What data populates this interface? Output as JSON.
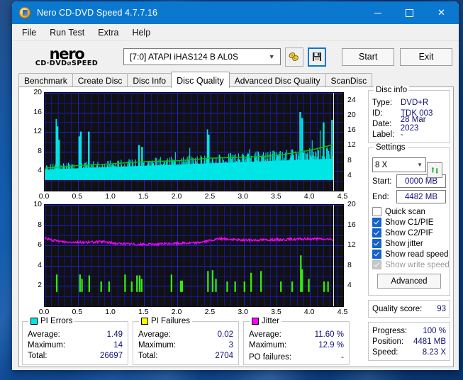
{
  "window": {
    "title": "Nero CD-DVD Speed 4.7.7.16",
    "icon": "disc-icon",
    "minimize": "—",
    "maximize": "□",
    "close": "✕",
    "accent": "#0b78d0"
  },
  "menu": {
    "items": [
      "File",
      "Run Test",
      "Extra",
      "Help"
    ]
  },
  "toolbar": {
    "logo_line1": "nero",
    "logo_line2": "CD·DVD⌀SPEED",
    "drive": "[7:0]   ATAPI iHAS124  B AL0S",
    "drive_chevron": "▼",
    "eject_icon": "disc-eject-icon",
    "save_icon": "floppy-save-icon",
    "start_label": "Start",
    "exit_label": "Exit"
  },
  "tabs": {
    "items": [
      "Benchmark",
      "Create Disc",
      "Disc Info",
      "Disc Quality",
      "Advanced Disc Quality",
      "ScanDisc"
    ],
    "active": "Disc Quality"
  },
  "disc_info": {
    "caption": "Disc info",
    "rows": [
      {
        "key": "Type:",
        "value": "DVD+R"
      },
      {
        "key": "ID:",
        "value": "TDK 003"
      },
      {
        "key": "Date:",
        "value": "28 Mar 2023"
      },
      {
        "key": "Label:",
        "value": "-"
      }
    ]
  },
  "settings": {
    "caption": "Settings",
    "speed": "8 X",
    "speed_chevron": "▼",
    "refresh_icon": "refresh-arrows-icon",
    "start_label": "Start:",
    "start_value": "0000 MB",
    "end_label": "End:",
    "end_value": "4482 MB",
    "checkboxes": [
      {
        "label": "Quick scan",
        "checked": false,
        "disabled": false
      },
      {
        "label": "Show C1/PIE",
        "checked": true,
        "disabled": false
      },
      {
        "label": "Show C2/PIF",
        "checked": true,
        "disabled": false
      },
      {
        "label": "Show jitter",
        "checked": true,
        "disabled": false
      },
      {
        "label": "Show read speed",
        "checked": true,
        "disabled": false
      },
      {
        "label": "Show write speed",
        "checked": true,
        "disabled": true
      }
    ],
    "advanced_label": "Advanced"
  },
  "quality": {
    "label": "Quality score:",
    "value": "93"
  },
  "progress": {
    "rows": [
      {
        "key": "Progress:",
        "value": "100 %"
      },
      {
        "key": "Position:",
        "value": "4481 MB"
      },
      {
        "key": "Speed:",
        "value": "8.23 X"
      }
    ]
  },
  "stats": {
    "pi_errors": {
      "caption": "PI Errors",
      "color": "#00e5e5",
      "rows": [
        {
          "key": "Average:",
          "value": "1.49"
        },
        {
          "key": "Maximum:",
          "value": "14"
        },
        {
          "key": "Total:",
          "value": "26697"
        }
      ]
    },
    "pi_failures": {
      "caption": "PI Failures",
      "color": "#ffff00",
      "rows": [
        {
          "key": "Average:",
          "value": "0.02"
        },
        {
          "key": "Maximum:",
          "value": "3"
        },
        {
          "key": "Total:",
          "value": "2704"
        }
      ]
    },
    "jitter": {
      "caption": "Jitter",
      "color": "#ff00ff",
      "rows": [
        {
          "key": "Average:",
          "value": "11.60 %"
        },
        {
          "key": "Maximum:",
          "value": "12.9 %"
        },
        {
          "key": "PO failures:",
          "value": "-"
        }
      ]
    }
  },
  "chart_data": [
    {
      "type": "bar",
      "title": "PI Errors / Read speed",
      "xlabel": "",
      "ylabel": "PI Errors",
      "xlim": [
        0.0,
        4.5
      ],
      "ylim": [
        0,
        20
      ],
      "y2lim": [
        0,
        26
      ],
      "xticks": [
        "0.0",
        "0.5",
        "1.0",
        "1.5",
        "2.0",
        "2.5",
        "3.0",
        "3.5",
        "4.0",
        "4.5"
      ],
      "yticks": [
        "4",
        "8",
        "12",
        "16",
        "20"
      ],
      "y2ticks": [
        "4",
        "8",
        "12",
        "16",
        "20",
        "24"
      ],
      "grid": true,
      "bg": "#111111",
      "grid_color": "#1f1fd8",
      "series": [
        {
          "name": "PI Errors",
          "kind": "bar",
          "color": "#00e5e5",
          "baseline": 2.6,
          "peaks": [
            [
              0.17,
              14
            ],
            [
              0.19,
              12.3
            ],
            [
              0.21,
              9.2
            ],
            [
              0.52,
              10.0
            ],
            [
              0.54,
              11.1
            ],
            [
              0.66,
              11.1
            ],
            [
              1.42,
              8.0
            ],
            [
              1.46,
              7.6
            ],
            [
              2.45,
              11.6
            ],
            [
              2.47,
              10.4
            ],
            [
              3.85,
              15.6
            ],
            [
              3.88,
              14.2
            ],
            [
              4.2,
              13.2
            ],
            [
              4.33,
              13.8
            ]
          ]
        },
        {
          "name": "Read speed",
          "kind": "line",
          "color": "#00d000",
          "points": [
            [
              0.0,
              2.7
            ],
            [
              0.5,
              3.3
            ],
            [
              1.0,
              3.7
            ],
            [
              1.5,
              4.2
            ],
            [
              2.0,
              4.4
            ],
            [
              2.5,
              5.0
            ],
            [
              3.0,
              5.2
            ],
            [
              3.5,
              5.6
            ],
            [
              4.0,
              6.8
            ],
            [
              4.35,
              8.1
            ]
          ]
        }
      ],
      "end_marker": 4.35
    },
    {
      "type": "line",
      "title": "Jitter / PI Failures",
      "xlabel": "",
      "ylabel": "PI Failures",
      "xlim": [
        0.0,
        4.5
      ],
      "ylim": [
        0,
        10
      ],
      "y2lim": [
        0,
        20
      ],
      "xticks": [
        "0.0",
        "0.5",
        "1.0",
        "1.5",
        "2.0",
        "2.5",
        "3.0",
        "3.5",
        "4.0",
        "4.5"
      ],
      "yticks": [
        "2",
        "4",
        "6",
        "8",
        "10"
      ],
      "y2ticks": [
        "4",
        "8",
        "12",
        "16",
        "20"
      ],
      "grid": true,
      "bg": "#111111",
      "grid_color": "#1f1fd8",
      "series": [
        {
          "name": "Jitter",
          "kind": "line",
          "color": "#ff00ff",
          "points": [
            [
              0.0,
              12.4
            ],
            [
              0.1,
              11.9
            ],
            [
              0.3,
              11.5
            ],
            [
              0.6,
              11.4
            ],
            [
              0.9,
              11.5
            ],
            [
              1.1,
              11.1
            ],
            [
              1.5,
              10.9
            ],
            [
              1.9,
              11.1
            ],
            [
              2.3,
              11.3
            ],
            [
              2.65,
              12.2
            ],
            [
              3.0,
              11.9
            ],
            [
              3.4,
              12.0
            ],
            [
              3.8,
              12.1
            ],
            [
              4.1,
              12.2
            ],
            [
              4.35,
              12.0
            ]
          ]
        },
        {
          "name": "PI Failures",
          "kind": "bar",
          "color": "#33ee00",
          "peaks": [
            [
              0.17,
              2.0
            ],
            [
              0.52,
              2.0
            ],
            [
              0.55,
              1.5
            ],
            [
              0.66,
              1.9
            ],
            [
              0.84,
              1.2
            ],
            [
              0.96,
              1.2
            ],
            [
              1.2,
              2.0
            ],
            [
              1.3,
              1.2
            ],
            [
              1.38,
              1.9
            ],
            [
              1.42,
              1.9
            ],
            [
              1.45,
              1.5
            ],
            [
              1.9,
              2.0
            ],
            [
              2.04,
              1.3
            ],
            [
              2.06,
              1.3
            ],
            [
              2.45,
              2.4
            ],
            [
              2.52,
              2.5
            ],
            [
              2.57,
              1.5
            ],
            [
              2.74,
              1.2
            ],
            [
              2.86,
              1.2
            ],
            [
              3.0,
              1.2
            ],
            [
              3.1,
              2.2
            ],
            [
              3.25,
              2.4
            ],
            [
              3.55,
              1.2
            ],
            [
              3.72,
              1.2
            ],
            [
              3.85,
              4.2
            ],
            [
              3.87,
              2.6
            ],
            [
              3.97,
              1.5
            ],
            [
              4.2,
              1.2
            ],
            [
              4.26,
              1.2
            ]
          ]
        }
      ],
      "end_marker": 4.35
    }
  ]
}
